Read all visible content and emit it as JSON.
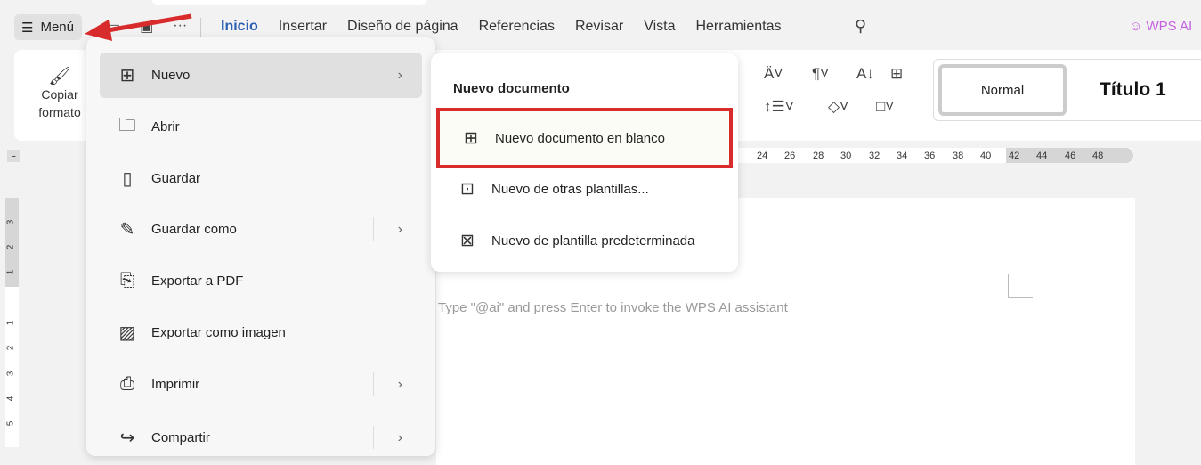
{
  "toolbar": {
    "menu_label": "Menú",
    "more": "···"
  },
  "tabs": [
    "Inicio",
    "Insertar",
    "Diseño de página",
    "Referencias",
    "Revisar",
    "Vista",
    "Herramientas"
  ],
  "wps_ai": "WPS AI",
  "ribbon": {
    "copy_format": [
      "Copiar",
      "formato"
    ],
    "styles": {
      "normal": "Normal",
      "heading1": "Título 1"
    }
  },
  "ruler": [
    "24",
    "26",
    "28",
    "30",
    "32",
    "34",
    "36",
    "38",
    "40",
    "42",
    "44",
    "46",
    "48"
  ],
  "vruler": [
    "3",
    "2",
    "1",
    "1",
    "2",
    "3",
    "4",
    "5"
  ],
  "document": {
    "hint": "Type \"@ai\" and press Enter to invoke the WPS AI assistant"
  },
  "menu": {
    "items": [
      {
        "label": "Nuevo",
        "icon": "new-file-icon",
        "submenu": true
      },
      {
        "label": "Abrir",
        "icon": "folder-icon"
      },
      {
        "label": "Guardar",
        "icon": "save-icon"
      },
      {
        "label": "Guardar como",
        "icon": "save-as-icon",
        "submenu": true
      },
      {
        "label": "Exportar a PDF",
        "icon": "pdf-icon"
      },
      {
        "label": "Exportar como imagen",
        "icon": "image-icon"
      },
      {
        "label": "Imprimir",
        "icon": "printer-icon",
        "submenu": true
      },
      {
        "label": "Compartir",
        "icon": "share-icon",
        "submenu": true
      }
    ]
  },
  "submenu": {
    "title": "Nuevo documento",
    "items": [
      {
        "label": "Nuevo documento en blanco",
        "icon": "blank-doc-icon"
      },
      {
        "label": "Nuevo de otras plantillas...",
        "icon": "template-icon"
      },
      {
        "label": "Nuevo de plantilla predeterminada",
        "icon": "default-template-icon"
      }
    ]
  },
  "colors": {
    "accent": "#2b5fb3",
    "highlight": "#d82b2b",
    "wps_ai": "#c561e0"
  }
}
